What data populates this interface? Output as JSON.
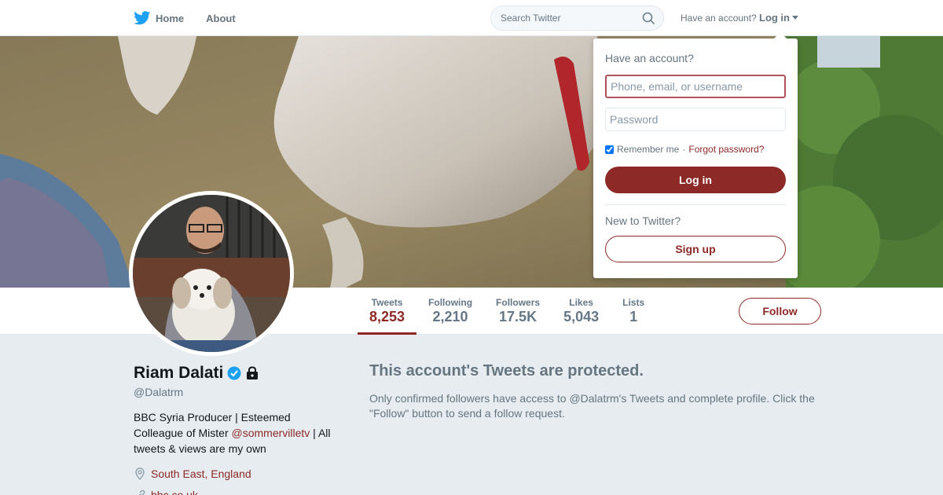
{
  "topbar": {
    "home_label": "Home",
    "about_label": "About",
    "search_placeholder": "Search Twitter",
    "account_question": "Have an account?",
    "login_label": "Log in"
  },
  "profile": {
    "name": "Riam Dalati",
    "handle": "@Dalatrm",
    "bio_part1": "BBC Syria Producer | Esteemed Colleague of Mister ",
    "bio_mention": "@sommervilletv",
    "bio_part2": " | All tweets & views are my own",
    "location": "South East, England",
    "url": "bbc.co.uk"
  },
  "stats": [
    {
      "label": "Tweets",
      "value": "8,253"
    },
    {
      "label": "Following",
      "value": "2,210"
    },
    {
      "label": "Followers",
      "value": "17.5K"
    },
    {
      "label": "Likes",
      "value": "5,043"
    },
    {
      "label": "Lists",
      "value": "1"
    }
  ],
  "follow_label": "Follow",
  "protected": {
    "title": "This account's Tweets are protected.",
    "text": "Only confirmed followers have access to @Dalatrm's Tweets and complete profile. Click the \"Follow\" button to send a follow request."
  },
  "login_dropdown": {
    "title": "Have an account?",
    "username_placeholder": "Phone, email, or username",
    "password_placeholder": "Password",
    "remember_label": "Remember me",
    "separator": "·",
    "forgot_label": "Forgot password?",
    "login_button": "Log in",
    "new_label": "New to Twitter?",
    "signup_button": "Sign up"
  },
  "colors": {
    "accent": "#8d2a28",
    "twitter_blue": "#1da1f2",
    "verified_blue": "#1da1f2",
    "background": "#e6ecf0"
  }
}
